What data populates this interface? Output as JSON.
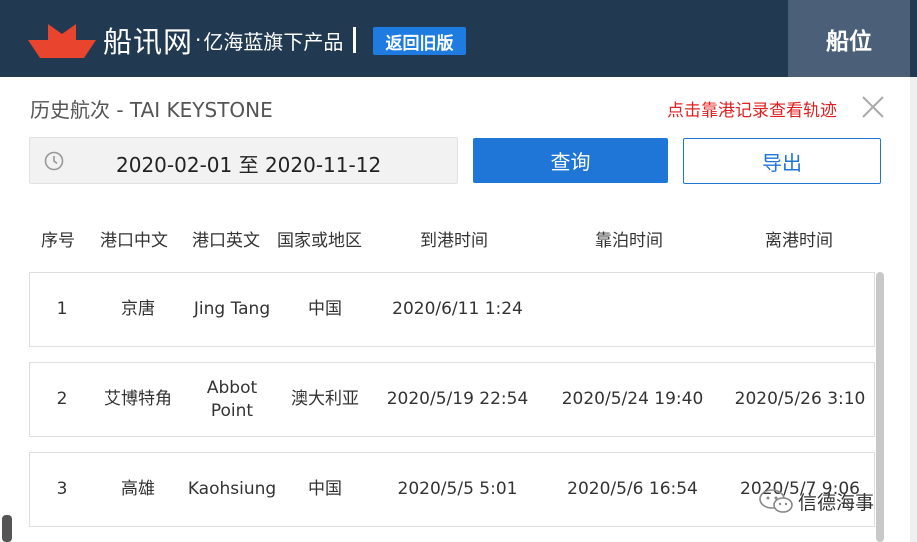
{
  "header": {
    "brand_main": "船讯网",
    "brand_dot": "·",
    "brand_sub": "亿海蓝旗下产品",
    "back_label": "返回旧版",
    "berth_tab": "船位"
  },
  "panel": {
    "title": "历史航次 - TAI KEYSTONE",
    "track_hint": "点击靠港记录查看轨迹",
    "date_range": "2020-02-01 至 2020-11-12",
    "query_label": "查询",
    "export_label": "导出"
  },
  "table": {
    "columns": [
      "序号",
      "港口中文",
      "港口英文",
      "国家或地区",
      "到港时间",
      "靠泊时间",
      "离港时间"
    ],
    "rows": [
      {
        "no": "1",
        "port_cn": "京唐",
        "port_en": "Jing Tang",
        "country": "中国",
        "arrive": "2020/6/11 1:24",
        "berth": "",
        "depart": ""
      },
      {
        "no": "2",
        "port_cn": "艾博特角",
        "port_en": "Abbot Point",
        "country": "澳大利亚",
        "arrive": "2020/5/19 22:54",
        "berth": "2020/5/24 19:40",
        "depart": "2020/5/26 3:10"
      },
      {
        "no": "3",
        "port_cn": "高雄",
        "port_en": "Kaohsiung",
        "country": "中国",
        "arrive": "2020/5/5 5:01",
        "berth": "2020/5/6 16:54",
        "depart": "2020/5/7 9:06"
      }
    ]
  },
  "watermark": {
    "text": "信德海事",
    "icon": "wechat-icon"
  },
  "colors": {
    "header_bg": "#213a52",
    "berth_tab_bg": "#4b6078",
    "accent_blue": "#1f76d6",
    "logo_red": "#e8442e",
    "hint_red": "#e02020"
  }
}
